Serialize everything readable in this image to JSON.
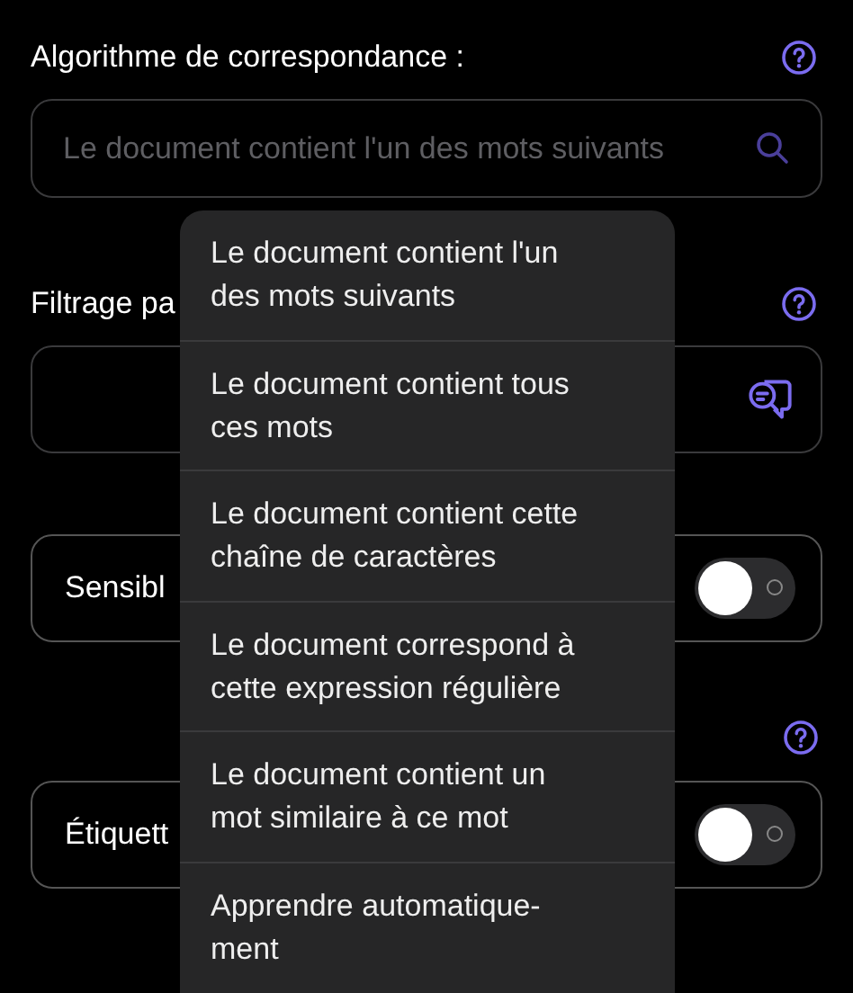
{
  "matching": {
    "label": "Algorithme de correspondance :",
    "field": {
      "placeholder": "Le document contient l'un des mots suivants"
    }
  },
  "filter": {
    "label": "Filtrage pa"
  },
  "toggles": [
    {
      "label": "Sensibl",
      "on": false
    },
    {
      "label": "Étiquett",
      "on": false
    }
  ],
  "menu": [
    {
      "label": "Le document contient l'un des mots suivants"
    },
    {
      "label": "Le document contient tous ces mots"
    },
    {
      "label": "Le document contient cette chaîne de caractères"
    },
    {
      "label": "Le document correspond à cette expression régulière"
    },
    {
      "label": "Le document contient un mot similaire à ce mot"
    },
    {
      "label": "Apprendre automatique-ment"
    }
  ]
}
